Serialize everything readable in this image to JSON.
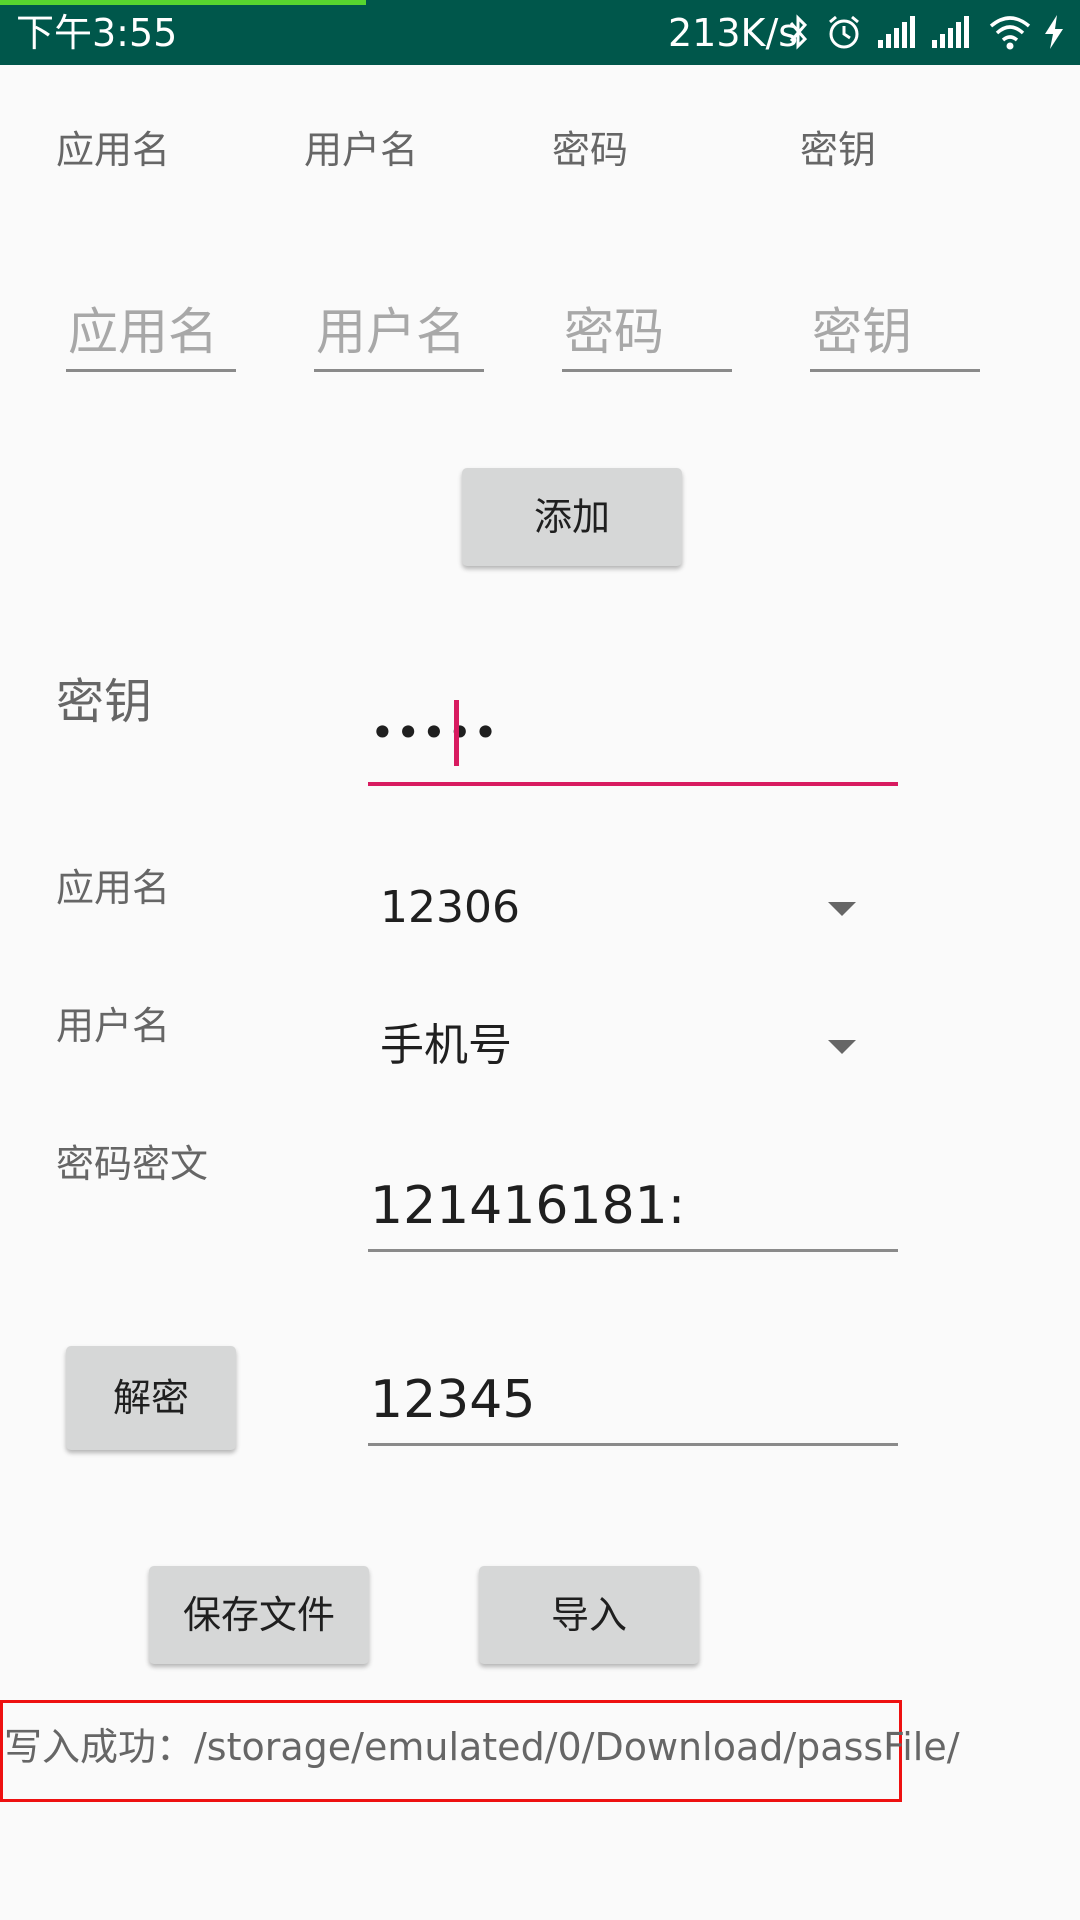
{
  "status_bar": {
    "time": "下午3:55",
    "net_speed": "213K/s",
    "icons": [
      "bluetooth-icon",
      "alarm-icon",
      "signal-icon",
      "signal-icon",
      "wifi-icon",
      "charging-icon"
    ],
    "color": "#00574b",
    "progress_color": "#57d52f"
  },
  "header": {
    "app_name": "应用名",
    "username": "用户名",
    "password": "密码",
    "key": "密钥"
  },
  "inputs": {
    "app_name_placeholder": "应用名",
    "username_placeholder": "用户名",
    "password_placeholder": "密码",
    "key_placeholder": "密钥"
  },
  "add_button": "添加",
  "key_row": {
    "label": "密钥",
    "value": "•••••",
    "accent": "#d81b60"
  },
  "app_row": {
    "label": "应用名",
    "value": "12306"
  },
  "user_row": {
    "label": "用户名",
    "value": "手机号"
  },
  "cipher_row": {
    "label": "密码密文",
    "value": "121416181:"
  },
  "decrypt_row": {
    "button": "解密",
    "value": "12345"
  },
  "actions": {
    "save": "保存文件",
    "import": "导入"
  },
  "result_text": "写入成功：/storage/emulated/0/Download/passFile/"
}
